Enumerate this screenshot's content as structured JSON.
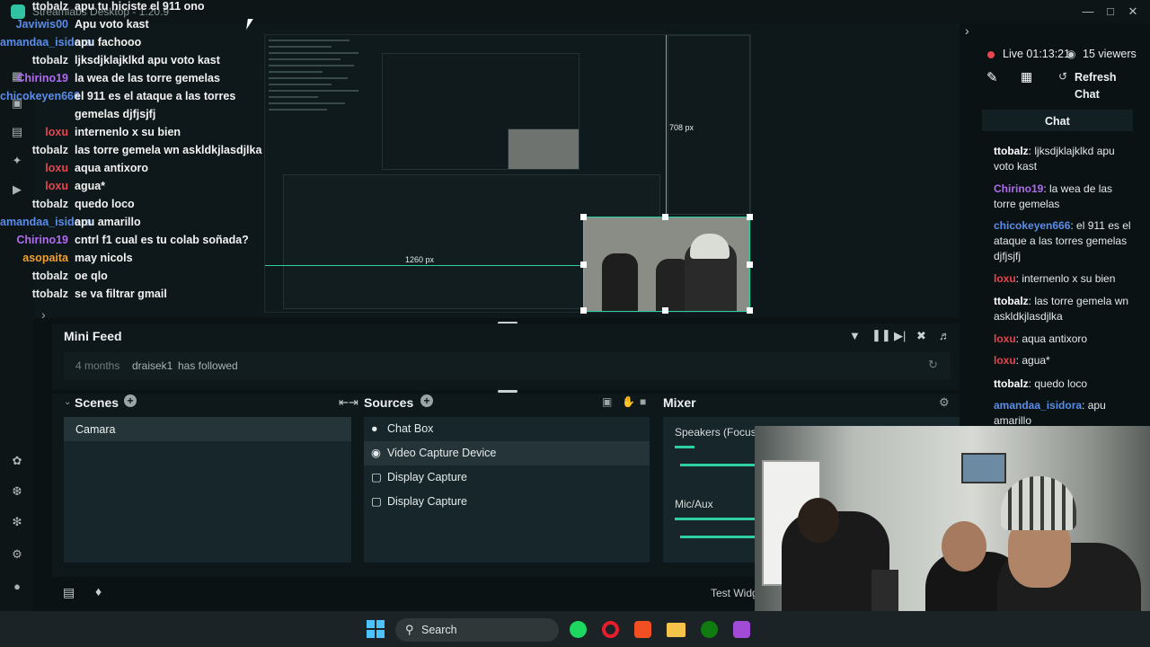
{
  "window": {
    "title": "Streamlabs Desktop - 1.20.9"
  },
  "overlay_chat": [
    {
      "user": "ttobalz",
      "msg": "apu tu hiciste el 911 ono",
      "color": "#e9e9e9"
    },
    {
      "user": "Javiwis00",
      "msg": "Apu voto kast",
      "color": "#5b8de8"
    },
    {
      "user": "amandaa_isidora",
      "msg": "apu fachooo",
      "color": "#5b8de8"
    },
    {
      "user": "ttobalz",
      "msg": "ljksdjklajklkd apu voto kast",
      "color": "#e9e9e9"
    },
    {
      "user": "Chirino19",
      "msg": "la wea de las torre gemelas",
      "color": "#b06cf0"
    },
    {
      "user": "chicokeyen666",
      "msg": "el 911 es el ataque a las torres",
      "color": "#5b8de8"
    },
    {
      "user": "",
      "msg": "gemelas djfjsjfj",
      "color": "#e9e9e9"
    },
    {
      "user": "loxu",
      "msg": "internenlo x su bien",
      "color": "#e8454e"
    },
    {
      "user": "ttobalz",
      "msg": "las torre gemela wn askldkjlasdjlka",
      "color": "#e9e9e9"
    },
    {
      "user": "loxu",
      "msg": "aqua antixoro",
      "color": "#e8454e"
    },
    {
      "user": "loxu",
      "msg": "agua*",
      "color": "#e8454e"
    },
    {
      "user": "ttobalz",
      "msg": "quedo loco",
      "color": "#e9e9e9"
    },
    {
      "user": "amandaa_isidora",
      "msg": "apu amarillo",
      "color": "#5b8de8"
    },
    {
      "user": "Chirino19",
      "msg": "cntrl f1 cual es tu colab soñada?",
      "color": "#b06cf0"
    },
    {
      "user": "asopaita",
      "msg": "may nicols",
      "color": "#f0a030"
    },
    {
      "user": "ttobalz",
      "msg": "oe qlo",
      "color": "#e9e9e9"
    },
    {
      "user": "ttobalz",
      "msg": "se va filtrar gmail",
      "color": "#e9e9e9"
    }
  ],
  "preview": {
    "width_readout": "1260 px",
    "height_readout": "708 px"
  },
  "live": {
    "label": "Live",
    "time": "01:13:21",
    "viewers": "15 viewers",
    "refresh": "Refresh",
    "chat_label": "Chat"
  },
  "chat_panel": {
    "title": "Chat",
    "messages": [
      {
        "user": "ttobalz",
        "text": ": ljksdjklajklkd apu voto kast",
        "color": "#ffffff"
      },
      {
        "user": "Chirino19",
        "text": ": la wea de las torre gemelas",
        "color": "#b06cf0"
      },
      {
        "user": "chicokeyen666",
        "text": ": el 911 es el ataque a las torres gemelas djfjsjfj",
        "color": "#5b8de8"
      },
      {
        "user": "loxu",
        "text": ": internenlo x su bien",
        "color": "#e8454e"
      },
      {
        "user": "ttobalz",
        "text": ": las torre gemela wn askldkjlasdjlka",
        "color": "#ffffff"
      },
      {
        "user": "loxu",
        "text": ": aqua antixoro",
        "color": "#e8454e"
      },
      {
        "user": "loxu",
        "text": ": agua*",
        "color": "#e8454e"
      },
      {
        "user": "ttobalz",
        "text": ": quedo loco",
        "color": "#ffffff"
      },
      {
        "user": "amandaa_isidora",
        "text": ": apu amarillo",
        "color": "#5b8de8"
      }
    ]
  },
  "mini_feed": {
    "title": "Mini Feed",
    "time": "4 months",
    "user": "draisek1",
    "action": "has followed"
  },
  "scenes": {
    "title": "Scenes",
    "items": [
      "Camara"
    ]
  },
  "sources": {
    "title": "Sources",
    "items": [
      "Chat Box",
      "Video Capture Device",
      "Display Capture",
      "Display Capture"
    ]
  },
  "mixer": {
    "title": "Mixer",
    "channels": [
      "Speakers (Focusr",
      "Mic/Aux"
    ]
  },
  "footer": {
    "test_widgets": "Test Widg"
  },
  "taskbar": {
    "search": "Search"
  }
}
